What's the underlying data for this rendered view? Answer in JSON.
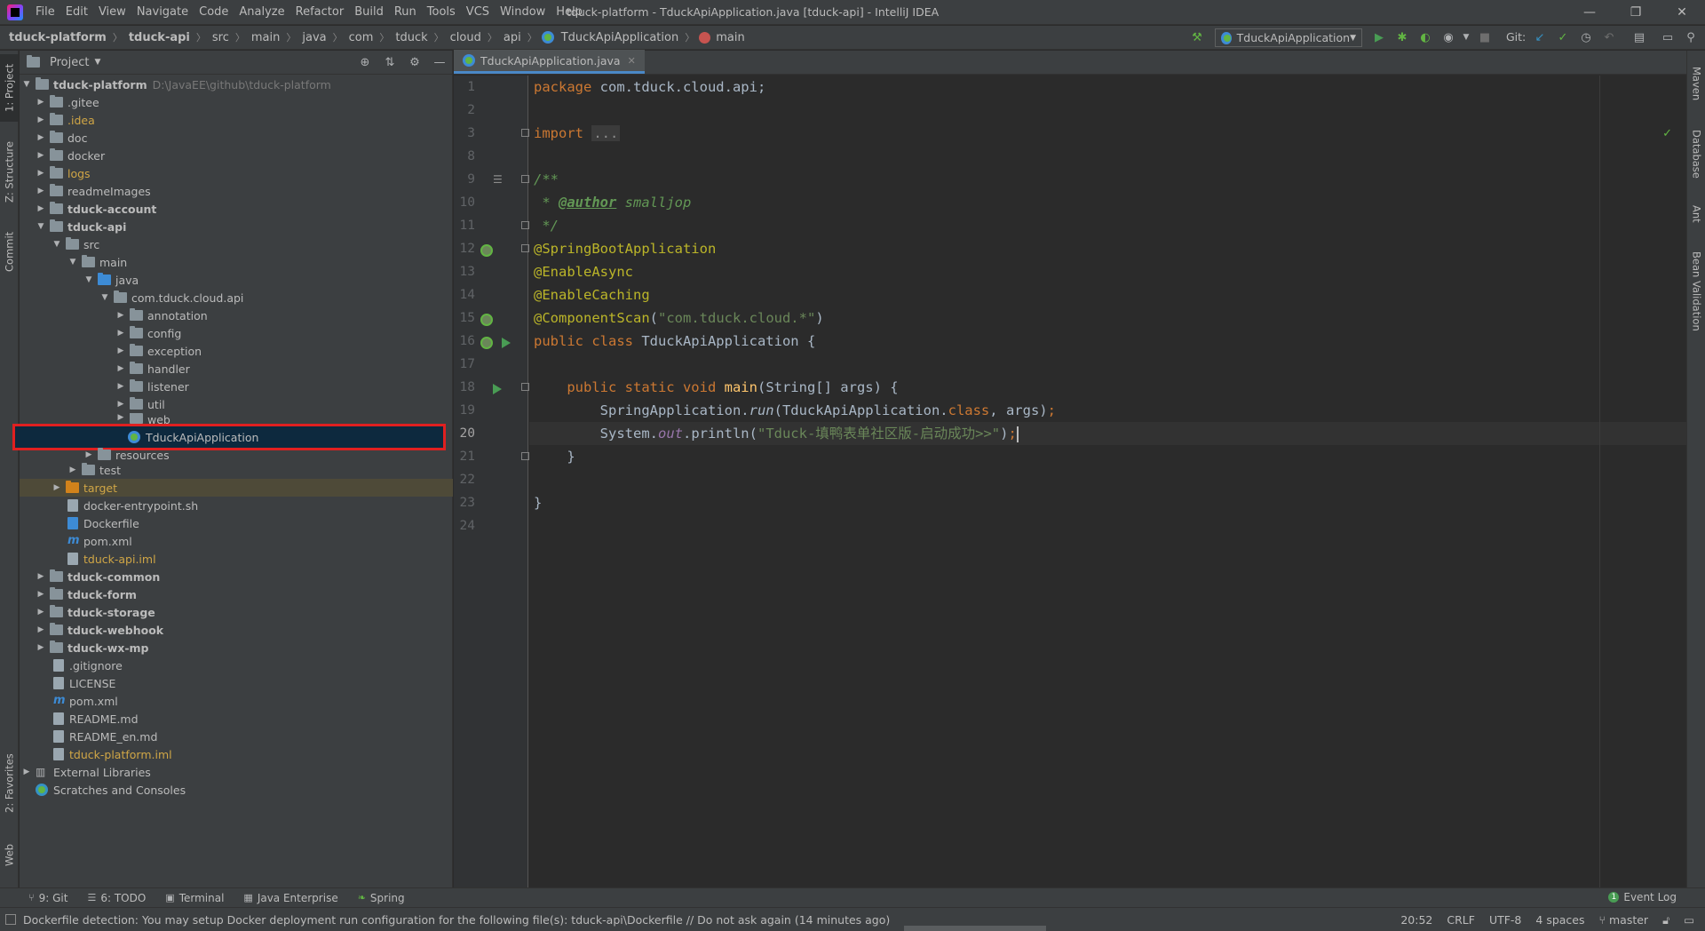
{
  "menubar": {
    "items": [
      "File",
      "Edit",
      "View",
      "Navigate",
      "Code",
      "Analyze",
      "Refactor",
      "Build",
      "Run",
      "Tools",
      "VCS",
      "Window",
      "Help"
    ],
    "window_title": "tduck-platform - TduckApiApplication.java [tduck-api] - IntelliJ IDEA"
  },
  "navbar": {
    "crumbs": [
      "tduck-platform",
      "tduck-api",
      "src",
      "main",
      "java",
      "com",
      "tduck",
      "cloud",
      "api",
      "TduckApiApplication",
      "main"
    ],
    "run_config": "TduckApiApplication",
    "git_label": "Git:"
  },
  "left_strip": {
    "project": "1: Project",
    "structure": "Z: Structure",
    "commit": "Commit",
    "favorites": "2: Favorites",
    "web": "Web"
  },
  "right_strip": {
    "maven": "Maven",
    "database": "Database",
    "ant": "Ant",
    "bean_validation": "Bean Validation"
  },
  "project_panel": {
    "title": "Project",
    "root_label": "tduck-platform",
    "root_path": "D:\\JavaEE\\github\\tduck-platform",
    "items": {
      "gitee": ".gitee",
      "idea": ".idea",
      "doc": "doc",
      "docker": "docker",
      "logs": "logs",
      "readme_images": "readmeImages",
      "tduck_account": "tduck-account",
      "tduck_api": "tduck-api",
      "src": "src",
      "main": "main",
      "java": "java",
      "package": "com.tduck.cloud.api",
      "annotation": "annotation",
      "config": "config",
      "exception": "exception",
      "handler": "handler",
      "listener": "listener",
      "util": "util",
      "web": "web",
      "app_class": "TduckApiApplication",
      "resources": "resources",
      "test": "test",
      "target": "target",
      "docker_entrypoint": "docker-entrypoint.sh",
      "dockerfile": "Dockerfile",
      "pom_api": "pom.xml",
      "api_iml": "tduck-api.iml",
      "tduck_common": "tduck-common",
      "tduck_form": "tduck-form",
      "tduck_storage": "tduck-storage",
      "tduck_webhook": "tduck-webhook",
      "tduck_wx_mp": "tduck-wx-mp",
      "gitignore": ".gitignore",
      "license": "LICENSE",
      "pom_root": "pom.xml",
      "readme": "README.md",
      "readme_en": "README_en.md",
      "platform_iml": "tduck-platform.iml",
      "external_libraries": "External Libraries",
      "scratches": "Scratches and Consoles"
    }
  },
  "editor": {
    "tab_label": "TduckApiApplication.java",
    "line_numbers": [
      "1",
      "2",
      "3",
      "8",
      "9",
      "10",
      "11",
      "12",
      "13",
      "14",
      "15",
      "16",
      "17",
      "18",
      "19",
      "20",
      "21",
      "22",
      "23",
      "24"
    ],
    "code": {
      "l1_kw": "package",
      "l1_rest": " com.tduck.cloud.api;",
      "l3_kw": "import",
      "l3_fold": "...",
      "l9": "/**",
      "l10_star": " * ",
      "l10_tag": "@author",
      "l10_name": " smalljop",
      "l11": " */",
      "l12": "@SpringBootApplication",
      "l13": "@EnableAsync",
      "l14": "@EnableCaching",
      "l15_ann": "@ComponentScan",
      "l15_open": "(",
      "l15_str": "\"com.tduck.cloud.*\"",
      "l15_close": ")",
      "l16_kw": "public class",
      "l16_name": " TduckApiApplication {",
      "l18_kw": "    public static void",
      "l18_mth": " main",
      "l18_rest": "(String[] args) {",
      "l19_a": "        SpringApplication.",
      "l19_run": "run",
      "l19_b": "(TduckApiApplication.",
      "l19_kw": "class",
      "l19_c": ", args)",
      "l19_semi": ";",
      "l20_a": "        System.",
      "l20_out": "out",
      "l20_b": ".println(",
      "l20_str": "\"Tduck-填鸭表单社区版-启动成功>>\"",
      "l20_c": ")",
      "l20_semi": ";",
      "l21": "    }",
      "l23": "}"
    }
  },
  "bottom_strip": {
    "git": "9: Git",
    "todo": "6: TODO",
    "terminal": "Terminal",
    "java_enterprise": "Java Enterprise",
    "spring": "Spring",
    "event_log": "Event Log",
    "event_count": "1"
  },
  "statusbar": {
    "message": "Dockerfile detection: You may setup Docker deployment run configuration for the following file(s): tduck-api\\Dockerfile // Do not ask again (14 minutes ago)",
    "position": "20:52",
    "line_sep": "CRLF",
    "encoding": "UTF-8",
    "indent": "4 spaces",
    "branch": "master"
  },
  "colors": {
    "accent": "#4a88c7",
    "selection_outline": "#e02020",
    "keyword": "#cc7832",
    "annotation": "#bbb529",
    "string": "#6a8759"
  }
}
